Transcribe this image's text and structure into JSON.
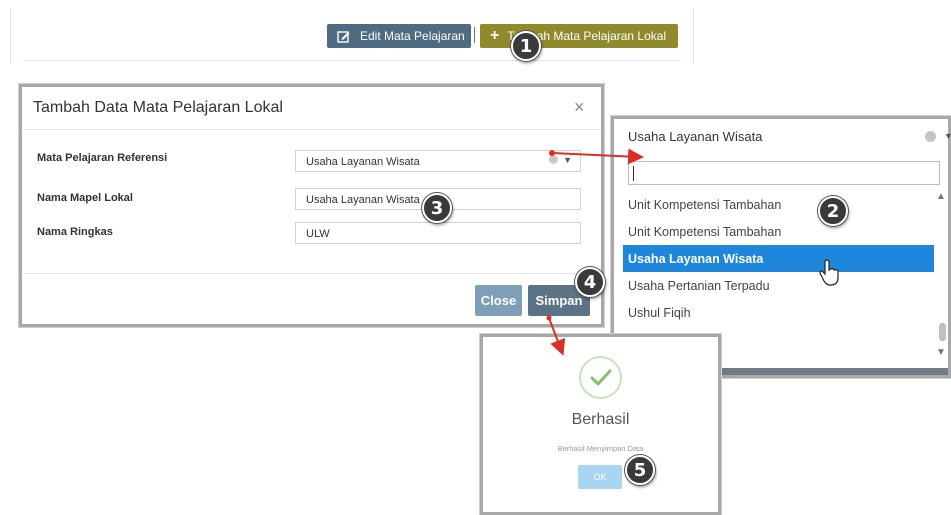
{
  "toolbar": {
    "edit_label": "Edit Mata Pelajaran",
    "add_label": "Tambah Mata Pelajaran Lokal"
  },
  "modal": {
    "title": "Tambah Data Mata Pelajaran Lokal",
    "close_glyph": "×",
    "fields": [
      {
        "label": "Mata Pelajaran Referensi",
        "value": "Usaha Layanan Wisata"
      },
      {
        "label": "Nama Mapel Lokal",
        "value": "Usaha Layanan Wisata"
      },
      {
        "label": "Nama Ringkas",
        "value": "ULW"
      }
    ],
    "close_button": "Close",
    "save_button": "Simpan"
  },
  "dropdown": {
    "selected": "Usaha Layanan Wisata",
    "search_value": "",
    "options": [
      "Unit Kompetensi Tambahan",
      "Unit Kompetensi Tambahan",
      "Usaha Layanan Wisata",
      "Usaha Pertanian Terpadu",
      "Ushul Fiqih"
    ],
    "active_index": 2
  },
  "success": {
    "title": "Berhasil",
    "message": "Berhasil Menyimpan Data",
    "ok_label": "OK"
  },
  "steps": [
    "1",
    "2",
    "3",
    "4",
    "5"
  ],
  "colors": {
    "edit_button": "#4f6b82",
    "add_button": "#8f8a2c",
    "active_option": "#1e87dc",
    "arrow": "#d93025",
    "check": "#7fc46b"
  },
  "icons": {
    "edit": "edit-icon",
    "add": "plus-icon",
    "check": "check-icon",
    "cursor": "hand-pointer-icon"
  }
}
